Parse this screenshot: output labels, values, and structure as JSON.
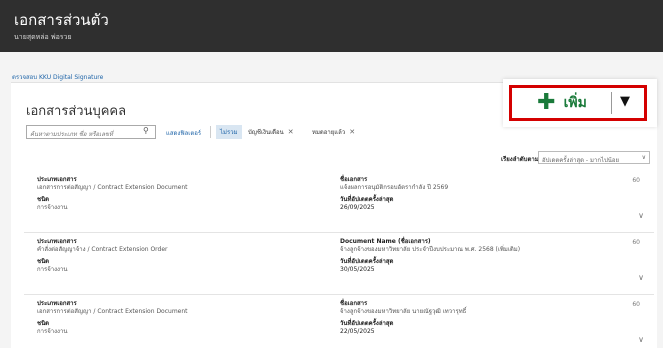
{
  "header": {
    "title": "เอกสารส่วนตัว",
    "subtitle": "นายสุดหล่อ พ่อรวย"
  },
  "verify_link": "ตรวจสอบ KKU Digital Signature",
  "page_title": "เอกสารส่วนบุคคล",
  "add_button": {
    "label": "เพิ่ม"
  },
  "search": {
    "placeholder": "ค้นหาตามประเภท ชื่อ หรือเลขที่"
  },
  "show_filter": "แสดงฟิลเตอร์",
  "filters": [
    {
      "label": "ไม่รวม"
    },
    {
      "label": "บัญชีเงินเดือน"
    },
    {
      "label": "หมดอายุแล้ว"
    }
  ],
  "sort": {
    "label": "เรียงลำดับตาม",
    "value": "อัปเดตครั้งล่าสุด - มากไปน้อย"
  },
  "documents": [
    {
      "type_label": "ประเภทเอกสาร",
      "type": "เอกสารการต่อสัญญา / Contract Extension Document",
      "kind_label": "ชนิด",
      "kind": "การจ้างงาน",
      "name_label": "ชื่อเอกสาร",
      "name": "แจ้งผลการอนุมัติกรอบอัตรากำลัง ปี 2569",
      "date_label": "วันที่อัปเดตครั้งล่าสุด",
      "date": "26/09/2025",
      "count": "60"
    },
    {
      "type_label": "ประเภทเอกสาร",
      "type": "คำสั่งต่อสัญญาจ้าง / Contract Extension Order",
      "kind_label": "ชนิด",
      "kind": "การจ้างงาน",
      "name_label": "Document Name (ชื่อเอกสาร)",
      "name": "จ้างลูกจ้างของมหาวิทยาลัย ประจำปีงบประมาณ พ.ศ. 2568 (เพิ่มเติม)",
      "date_label": "วันที่อัปเดตครั้งล่าสุด",
      "date": "30/05/2025",
      "count": "60"
    },
    {
      "type_label": "ประเภทเอกสาร",
      "type": "เอกสารการต่อสัญญา / Contract Extension Document",
      "kind_label": "ชนิด",
      "kind": "การจ้างงาน",
      "name_label": "ชื่อเอกสาร",
      "name": "จ้างลูกจ้างของมหาวิทยาลัย นายณัฐวุฒิ เทวารุทธิ์",
      "date_label": "วันที่อัปเดตครั้งล่าสุด",
      "date": "22/05/2025",
      "count": "60"
    }
  ],
  "colors": {
    "topbar": "#2f2f2f",
    "accent_green": "#1a7a3a",
    "highlight_red": "#d40000",
    "link_blue": "#1e64a8"
  }
}
